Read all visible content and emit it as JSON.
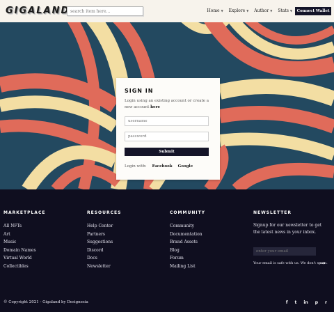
{
  "header": {
    "logo": "GIGALAND",
    "search_placeholder": "search item here...",
    "nav": [
      {
        "label": "Home"
      },
      {
        "label": "Explore"
      },
      {
        "label": "Author"
      },
      {
        "label": "Stats"
      }
    ],
    "connect_label": "Connect Wallet"
  },
  "signin": {
    "title": "SIGN IN",
    "subtitle_prefix": "Login using an existing account or create a new account ",
    "subtitle_link": "here",
    "username_placeholder": "username",
    "password_placeholder": "password",
    "submit_label": "Submit",
    "login_with": "Login with:",
    "facebook": "Facebook",
    "google": "Google"
  },
  "footer": {
    "columns": [
      {
        "title": "MARKETPLACE",
        "links": [
          "All NFTs",
          "Art",
          "Music",
          "Domain Names",
          "Virtual World",
          "Collectibles"
        ]
      },
      {
        "title": "RESOURCES",
        "links": [
          "Help Center",
          "Partners",
          "Suggestions",
          "Discord",
          "Docs",
          "Newsletter"
        ]
      },
      {
        "title": "COMMUNITY",
        "links": [
          "Community",
          "Documentation",
          "Brand Assets",
          "Blog",
          "Forum",
          "Mailing List"
        ]
      }
    ],
    "newsletter": {
      "title": "NEWSLETTER",
      "text": "Signup for our newsletter to get the latest news in your inbox.",
      "email_placeholder": "enter your email",
      "note": "Your email is safe with us. We don't spam."
    },
    "copyright": "© Copyright 2021 - Gigaland by Designesia",
    "social_icons": [
      "facebook-icon",
      "twitter-icon",
      "linkedin-icon",
      "pinterest-icon",
      "rss-icon"
    ]
  },
  "colors": {
    "hero_blue": "#234960",
    "hero_red": "#e06b5a",
    "hero_cream": "#f3dea3",
    "dark": "#141428"
  }
}
